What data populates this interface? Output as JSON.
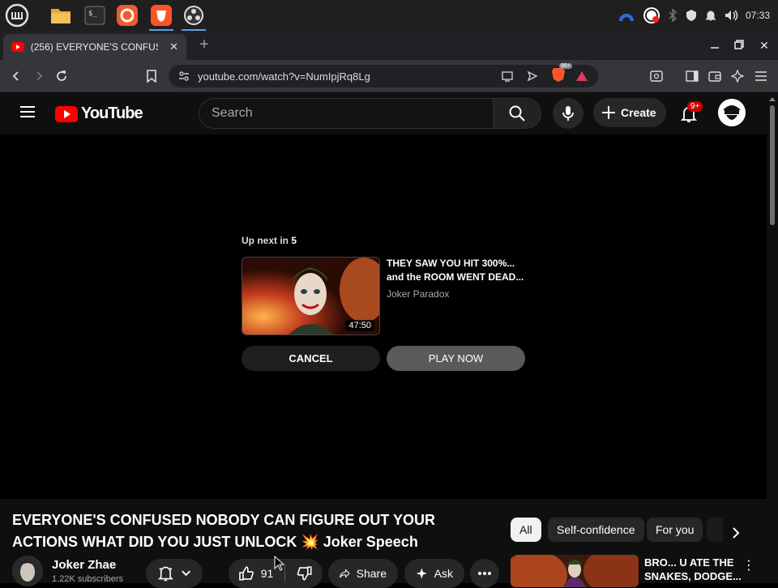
{
  "taskbar": {
    "apps": [
      {
        "name": "mint-menu-icon"
      },
      {
        "name": "files-icon"
      },
      {
        "name": "terminal-icon"
      },
      {
        "name": "firefox-dev-icon"
      },
      {
        "name": "brave-icon"
      },
      {
        "name": "obs-icon"
      }
    ],
    "clock": "07:33"
  },
  "browser": {
    "tab_title": "(256) EVERYONE'S CONFUSED",
    "url": "youtube.com/watch?v=NumIpjRq8Lg",
    "shields_badge": "99+"
  },
  "youtube": {
    "logo_text": "YouTube",
    "search_placeholder": "Search",
    "create_label": "Create",
    "notif_badge": "9+"
  },
  "endscreen": {
    "upnext_prefix": "Up next in",
    "upnext_count": "5",
    "title": "THEY SAW YOU HIT 300%... and the ROOM WENT DEAD...",
    "channel": "Joker Paradox",
    "duration": "47:50",
    "cancel_label": "CANCEL",
    "play_label": "PLAY NOW"
  },
  "video": {
    "title": "EVERYONE'S CONFUSED NOBODY CAN FIGURE OUT YOUR ACTIONS WHAT DID YOU JUST UNLOCK 💥 Joker Speech",
    "channel_name": "Joker Zhae",
    "subscribers": "1.22K subscribers",
    "likes": "91",
    "share_label": "Share",
    "ask_label": "Ask"
  },
  "chips": [
    {
      "label": "All",
      "active": true
    },
    {
      "label": "Self-confidence",
      "active": false
    },
    {
      "label": "For you",
      "active": false
    }
  ],
  "recommended": {
    "title": "BRO... U ATE THE SNAKES, DODGE..."
  },
  "colors": {
    "yt_red": "#ff0000",
    "background": "#0f0f0f",
    "chip_bg": "#272727"
  }
}
